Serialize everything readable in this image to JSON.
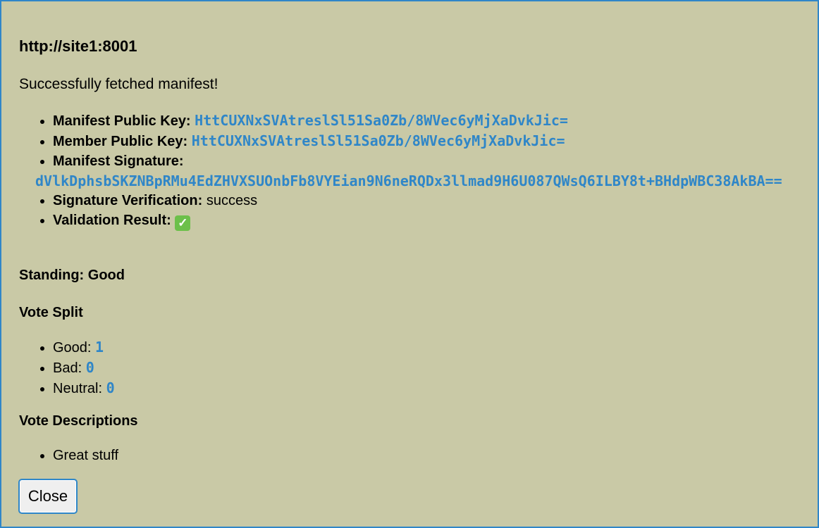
{
  "dialog": {
    "title": "http://site1:8001",
    "status_message": "Successfully fetched manifest!",
    "details": {
      "manifest_public_key_label": "Manifest Public Key:",
      "manifest_public_key": "HttCUXNxSVAtreslSl51Sa0Zb/8WVec6yMjXaDvkJic=",
      "member_public_key_label": "Member Public Key:",
      "member_public_key": "HttCUXNxSVAtreslSl51Sa0Zb/8WVec6yMjXaDvkJic=",
      "manifest_signature_label": "Manifest Signature:",
      "manifest_signature": "dVlkDphsbSKZNBpRMu4EdZHVXSUOnbFb8VYEian9N6neRQDx3llmad9H6U087QWsQ6ILBY8t+BHdpWBC38AkBA==",
      "signature_verification_label": "Signature Verification:",
      "signature_verification": "success",
      "validation_result_label": "Validation Result:",
      "validation_result_icon": "✓"
    },
    "standing": "Standing: Good",
    "vote_split": {
      "heading": "Vote Split",
      "good_label": "Good:",
      "good_count": "1",
      "bad_label": "Bad:",
      "bad_count": "0",
      "neutral_label": "Neutral:",
      "neutral_count": "0"
    },
    "vote_descriptions": {
      "heading": "Vote Descriptions",
      "items": [
        "Great stuff"
      ]
    },
    "close_label": "Close"
  },
  "colors": {
    "background": "#c9c9a6",
    "accent": "#2f86c8",
    "check_green": "#6cc04a"
  },
  "icons": {
    "validation": "check-mark-icon"
  }
}
